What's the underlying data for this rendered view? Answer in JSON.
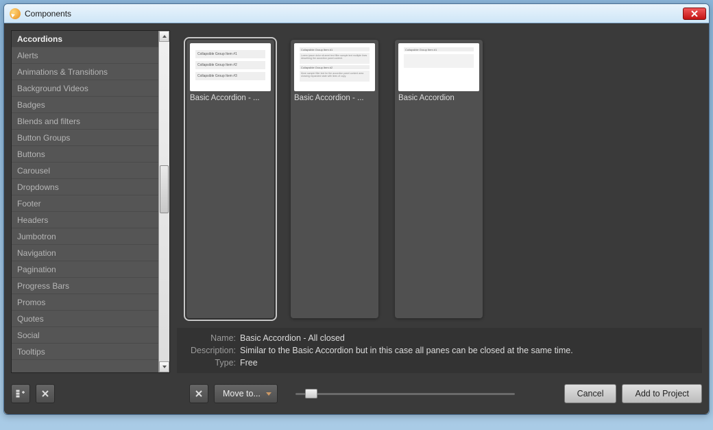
{
  "window": {
    "title": "Components"
  },
  "categories": [
    "Accordions",
    "Alerts",
    "Animations & Transitions",
    "Background Videos",
    "Badges",
    "Blends and filters",
    "Button Groups",
    "Buttons",
    "Carousel",
    "Dropdowns",
    "Footer",
    "Headers",
    "Jumbotron",
    "Navigation",
    "Pagination",
    "Progress Bars",
    "Promos",
    "Quotes",
    "Social",
    "Tooltips"
  ],
  "selected_category_index": 0,
  "items": [
    {
      "label": "Basic Accordion - ...",
      "selected": true
    },
    {
      "label": "Basic Accordion - ...",
      "selected": false
    },
    {
      "label": "Basic Accordion",
      "selected": false
    }
  ],
  "details": {
    "name_label": "Name:",
    "name_value": "Basic Accordion - All closed",
    "description_label": "Description:",
    "description_value": "Similar to the Basic Accordion but in this case all panes can be closed at the same time.",
    "type_label": "Type:",
    "type_value": "Free"
  },
  "buttons": {
    "move_to": "Move to...",
    "cancel": "Cancel",
    "add_to_project": "Add to Project"
  },
  "thumb_text": {
    "r1": "Collapsible Group Item #1",
    "r2": "Collapsible Group Item #2",
    "r3": "Collapsible Group Item #3"
  }
}
